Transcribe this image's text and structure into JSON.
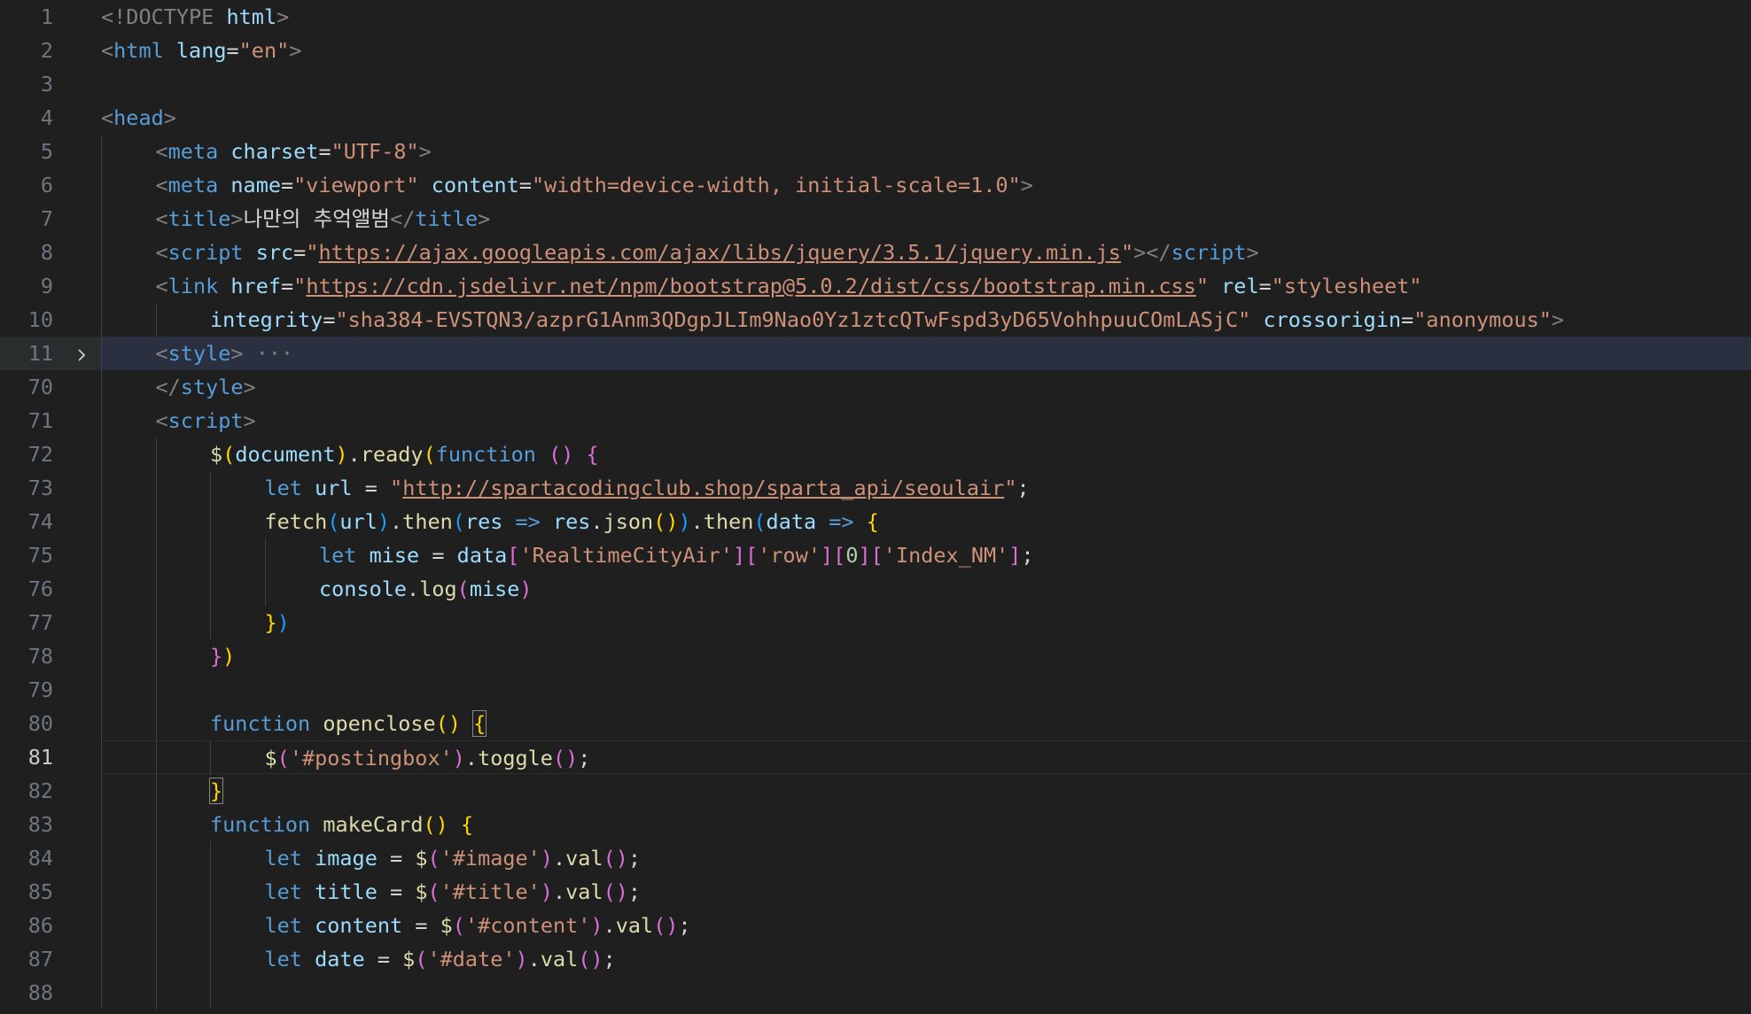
{
  "editor": {
    "active_line": "81",
    "lines": [
      {
        "num": "1",
        "indent": 0,
        "tokens": [
          [
            "t-punct",
            "<!"
          ],
          [
            "t-doc",
            "DOCTYPE"
          ],
          [
            "t-text",
            " "
          ],
          [
            "t-attr",
            "html"
          ],
          [
            "t-punct",
            ">"
          ]
        ]
      },
      {
        "num": "2",
        "indent": 0,
        "tokens": [
          [
            "t-punct",
            "<"
          ],
          [
            "t-tag",
            "html"
          ],
          [
            "t-text",
            " "
          ],
          [
            "t-attr",
            "lang"
          ],
          [
            "t-text",
            "="
          ],
          [
            "t-str",
            "\"en\""
          ],
          [
            "t-punct",
            ">"
          ]
        ]
      },
      {
        "num": "3",
        "indent": 0,
        "tokens": []
      },
      {
        "num": "4",
        "indent": 0,
        "tokens": [
          [
            "t-punct",
            "<"
          ],
          [
            "t-tag",
            "head"
          ],
          [
            "t-punct",
            ">"
          ]
        ]
      },
      {
        "num": "5",
        "indent": 1,
        "tokens": [
          [
            "t-punct",
            "<"
          ],
          [
            "t-tag",
            "meta"
          ],
          [
            "t-text",
            " "
          ],
          [
            "t-attr",
            "charset"
          ],
          [
            "t-text",
            "="
          ],
          [
            "t-str",
            "\"UTF-8\""
          ],
          [
            "t-punct",
            ">"
          ]
        ]
      },
      {
        "num": "6",
        "indent": 1,
        "tokens": [
          [
            "t-punct",
            "<"
          ],
          [
            "t-tag",
            "meta"
          ],
          [
            "t-text",
            " "
          ],
          [
            "t-attr",
            "name"
          ],
          [
            "t-text",
            "="
          ],
          [
            "t-str",
            "\"viewport\""
          ],
          [
            "t-text",
            " "
          ],
          [
            "t-attr",
            "content"
          ],
          [
            "t-text",
            "="
          ],
          [
            "t-str",
            "\"width=device-width, initial-scale=1.0\""
          ],
          [
            "t-punct",
            ">"
          ]
        ]
      },
      {
        "num": "7",
        "indent": 1,
        "tokens": [
          [
            "t-punct",
            "<"
          ],
          [
            "t-tag",
            "title"
          ],
          [
            "t-punct",
            ">"
          ],
          [
            "t-text",
            "나만의 추억앨범"
          ],
          [
            "t-punct",
            "</"
          ],
          [
            "t-tag",
            "title"
          ],
          [
            "t-punct",
            ">"
          ]
        ]
      },
      {
        "num": "8",
        "indent": 1,
        "tokens": [
          [
            "t-punct",
            "<"
          ],
          [
            "t-tag",
            "script"
          ],
          [
            "t-text",
            " "
          ],
          [
            "t-attr",
            "src"
          ],
          [
            "t-text",
            "="
          ],
          [
            "t-str",
            "\""
          ],
          [
            "t-str t-url",
            "https://ajax.googleapis.com/ajax/libs/jquery/3.5.1/jquery.min.js"
          ],
          [
            "t-str",
            "\""
          ],
          [
            "t-punct",
            "></"
          ],
          [
            "t-tag",
            "script"
          ],
          [
            "t-punct",
            ">"
          ]
        ]
      },
      {
        "num": "9",
        "indent": 1,
        "tokens": [
          [
            "t-punct",
            "<"
          ],
          [
            "t-tag",
            "link"
          ],
          [
            "t-text",
            " "
          ],
          [
            "t-attr",
            "href"
          ],
          [
            "t-text",
            "="
          ],
          [
            "t-str",
            "\""
          ],
          [
            "t-str t-url",
            "https://cdn.jsdelivr.net/npm/bootstrap@5.0.2/dist/css/bootstrap.min.css"
          ],
          [
            "t-str",
            "\""
          ],
          [
            "t-text",
            " "
          ],
          [
            "t-attr",
            "rel"
          ],
          [
            "t-text",
            "="
          ],
          [
            "t-str",
            "\"stylesheet\""
          ]
        ]
      },
      {
        "num": "10",
        "indent": 2,
        "tokens": [
          [
            "t-attr",
            "integrity"
          ],
          [
            "t-text",
            "="
          ],
          [
            "t-str",
            "\"sha384-EVSTQN3/azprG1Anm3QDgpJLIm9Nao0Yz1ztcQTwFspd3yD65VohhpuuCOmLASjC\""
          ],
          [
            "t-text",
            " "
          ],
          [
            "t-attr",
            "crossorigin"
          ],
          [
            "t-text",
            "="
          ],
          [
            "t-str",
            "\"anonymous\""
          ],
          [
            "t-punct",
            ">"
          ]
        ]
      },
      {
        "num": "11",
        "indent": 1,
        "folded": true,
        "tokens": [
          [
            "t-punct",
            "<"
          ],
          [
            "t-tag",
            "style"
          ],
          [
            "t-punct",
            ">"
          ],
          [
            "t-ellipsis",
            " ···"
          ]
        ]
      },
      {
        "num": "70",
        "indent": 1,
        "tokens": [
          [
            "t-punct",
            "</"
          ],
          [
            "t-tag",
            "style"
          ],
          [
            "t-punct",
            ">"
          ]
        ]
      },
      {
        "num": "71",
        "indent": 1,
        "tokens": [
          [
            "t-punct",
            "<"
          ],
          [
            "t-tag",
            "script"
          ],
          [
            "t-punct",
            ">"
          ]
        ]
      },
      {
        "num": "72",
        "indent": 2,
        "tokens": [
          [
            "t-fn",
            "$"
          ],
          [
            "t-b1",
            "("
          ],
          [
            "t-var",
            "document"
          ],
          [
            "t-b1",
            ")"
          ],
          [
            "t-op",
            "."
          ],
          [
            "t-fn",
            "ready"
          ],
          [
            "t-b1",
            "("
          ],
          [
            "t-kw",
            "function"
          ],
          [
            "t-text",
            " "
          ],
          [
            "t-b2",
            "()"
          ],
          [
            "t-text",
            " "
          ],
          [
            "t-b2",
            "{"
          ]
        ]
      },
      {
        "num": "73",
        "indent": 3,
        "tokens": [
          [
            "t-kw",
            "let"
          ],
          [
            "t-text",
            " "
          ],
          [
            "t-var",
            "url"
          ],
          [
            "t-text",
            " "
          ],
          [
            "t-op",
            "="
          ],
          [
            "t-text",
            " "
          ],
          [
            "t-str",
            "\""
          ],
          [
            "t-str t-url",
            "http://spartacodingclub.shop/sparta_api/seoulair"
          ],
          [
            "t-str",
            "\""
          ],
          [
            "t-op",
            ";"
          ]
        ]
      },
      {
        "num": "74",
        "indent": 3,
        "tokens": [
          [
            "t-fn",
            "fetch"
          ],
          [
            "t-b3",
            "("
          ],
          [
            "t-var",
            "url"
          ],
          [
            "t-b3",
            ")"
          ],
          [
            "t-op",
            "."
          ],
          [
            "t-fn",
            "then"
          ],
          [
            "t-b3",
            "("
          ],
          [
            "t-var",
            "res"
          ],
          [
            "t-text",
            " "
          ],
          [
            "t-kw",
            "=>"
          ],
          [
            "t-text",
            " "
          ],
          [
            "t-var",
            "res"
          ],
          [
            "t-op",
            "."
          ],
          [
            "t-fn",
            "json"
          ],
          [
            "t-b1",
            "()"
          ],
          [
            "t-b3",
            ")"
          ],
          [
            "t-op",
            "."
          ],
          [
            "t-fn",
            "then"
          ],
          [
            "t-b3",
            "("
          ],
          [
            "t-var",
            "data"
          ],
          [
            "t-text",
            " "
          ],
          [
            "t-kw",
            "=>"
          ],
          [
            "t-text",
            " "
          ],
          [
            "t-b1",
            "{"
          ]
        ]
      },
      {
        "num": "75",
        "indent": 4,
        "tokens": [
          [
            "t-kw",
            "let"
          ],
          [
            "t-text",
            " "
          ],
          [
            "t-var",
            "mise"
          ],
          [
            "t-text",
            " "
          ],
          [
            "t-op",
            "="
          ],
          [
            "t-text",
            " "
          ],
          [
            "t-var",
            "data"
          ],
          [
            "t-b2",
            "["
          ],
          [
            "t-str",
            "'RealtimeCityAir'"
          ],
          [
            "t-b2",
            "]"
          ],
          [
            "t-b2",
            "["
          ],
          [
            "t-str",
            "'row'"
          ],
          [
            "t-b2",
            "]"
          ],
          [
            "t-b2",
            "["
          ],
          [
            "t-num",
            "0"
          ],
          [
            "t-b2",
            "]"
          ],
          [
            "t-b2",
            "["
          ],
          [
            "t-str",
            "'Index_NM'"
          ],
          [
            "t-b2",
            "]"
          ],
          [
            "t-op",
            ";"
          ]
        ]
      },
      {
        "num": "76",
        "indent": 4,
        "tokens": [
          [
            "t-var",
            "console"
          ],
          [
            "t-op",
            "."
          ],
          [
            "t-fn",
            "log"
          ],
          [
            "t-b2",
            "("
          ],
          [
            "t-var",
            "mise"
          ],
          [
            "t-b2",
            ")"
          ]
        ]
      },
      {
        "num": "77",
        "indent": 3,
        "tokens": [
          [
            "t-b1",
            "}"
          ],
          [
            "t-b3",
            ")"
          ]
        ]
      },
      {
        "num": "78",
        "indent": 2,
        "tokens": [
          [
            "t-b2",
            "}"
          ],
          [
            "t-b1",
            ")"
          ]
        ]
      },
      {
        "num": "79",
        "indent": 2,
        "tokens": []
      },
      {
        "num": "80",
        "indent": 2,
        "tokens": [
          [
            "t-kw",
            "function"
          ],
          [
            "t-text",
            " "
          ],
          [
            "t-fn",
            "openclose"
          ],
          [
            "t-b1",
            "()"
          ],
          [
            "t-text",
            " "
          ],
          [
            "t-b1 t-bracket-match",
            "{"
          ]
        ]
      },
      {
        "num": "81",
        "indent": 3,
        "active": true,
        "tokens": [
          [
            "t-fn",
            "$"
          ],
          [
            "t-b2",
            "("
          ],
          [
            "t-str",
            "'#postingbox'"
          ],
          [
            "t-b2",
            ")"
          ],
          [
            "t-op",
            "."
          ],
          [
            "t-fn",
            "toggle"
          ],
          [
            "t-b2",
            "()"
          ],
          [
            "t-op",
            ";"
          ]
        ]
      },
      {
        "num": "82",
        "indent": 2,
        "tokens": [
          [
            "t-b1 t-bracket-match",
            "}"
          ]
        ]
      },
      {
        "num": "83",
        "indent": 2,
        "tokens": [
          [
            "t-kw",
            "function"
          ],
          [
            "t-text",
            " "
          ],
          [
            "t-fn",
            "makeCard"
          ],
          [
            "t-b1",
            "()"
          ],
          [
            "t-text",
            " "
          ],
          [
            "t-b1",
            "{"
          ]
        ]
      },
      {
        "num": "84",
        "indent": 3,
        "tokens": [
          [
            "t-kw",
            "let"
          ],
          [
            "t-text",
            " "
          ],
          [
            "t-var",
            "image"
          ],
          [
            "t-text",
            " "
          ],
          [
            "t-op",
            "="
          ],
          [
            "t-text",
            " "
          ],
          [
            "t-fn",
            "$"
          ],
          [
            "t-b2",
            "("
          ],
          [
            "t-str",
            "'#image'"
          ],
          [
            "t-b2",
            ")"
          ],
          [
            "t-op",
            "."
          ],
          [
            "t-fn",
            "val"
          ],
          [
            "t-b2",
            "()"
          ],
          [
            "t-op",
            ";"
          ]
        ]
      },
      {
        "num": "85",
        "indent": 3,
        "tokens": [
          [
            "t-kw",
            "let"
          ],
          [
            "t-text",
            " "
          ],
          [
            "t-var",
            "title"
          ],
          [
            "t-text",
            " "
          ],
          [
            "t-op",
            "="
          ],
          [
            "t-text",
            " "
          ],
          [
            "t-fn",
            "$"
          ],
          [
            "t-b2",
            "("
          ],
          [
            "t-str",
            "'#title'"
          ],
          [
            "t-b2",
            ")"
          ],
          [
            "t-op",
            "."
          ],
          [
            "t-fn",
            "val"
          ],
          [
            "t-b2",
            "()"
          ],
          [
            "t-op",
            ";"
          ]
        ]
      },
      {
        "num": "86",
        "indent": 3,
        "tokens": [
          [
            "t-kw",
            "let"
          ],
          [
            "t-text",
            " "
          ],
          [
            "t-var",
            "content"
          ],
          [
            "t-text",
            " "
          ],
          [
            "t-op",
            "="
          ],
          [
            "t-text",
            " "
          ],
          [
            "t-fn",
            "$"
          ],
          [
            "t-b2",
            "("
          ],
          [
            "t-str",
            "'#content'"
          ],
          [
            "t-b2",
            ")"
          ],
          [
            "t-op",
            "."
          ],
          [
            "t-fn",
            "val"
          ],
          [
            "t-b2",
            "()"
          ],
          [
            "t-op",
            ";"
          ]
        ]
      },
      {
        "num": "87",
        "indent": 3,
        "tokens": [
          [
            "t-kw",
            "let"
          ],
          [
            "t-text",
            " "
          ],
          [
            "t-var",
            "date"
          ],
          [
            "t-text",
            " "
          ],
          [
            "t-op",
            "="
          ],
          [
            "t-text",
            " "
          ],
          [
            "t-fn",
            "$"
          ],
          [
            "t-b2",
            "("
          ],
          [
            "t-str",
            "'#date'"
          ],
          [
            "t-b2",
            ")"
          ],
          [
            "t-op",
            "."
          ],
          [
            "t-fn",
            "val"
          ],
          [
            "t-b2",
            "()"
          ],
          [
            "t-op",
            ";"
          ]
        ]
      },
      {
        "num": "88",
        "indent": 3,
        "tokens": []
      }
    ]
  }
}
